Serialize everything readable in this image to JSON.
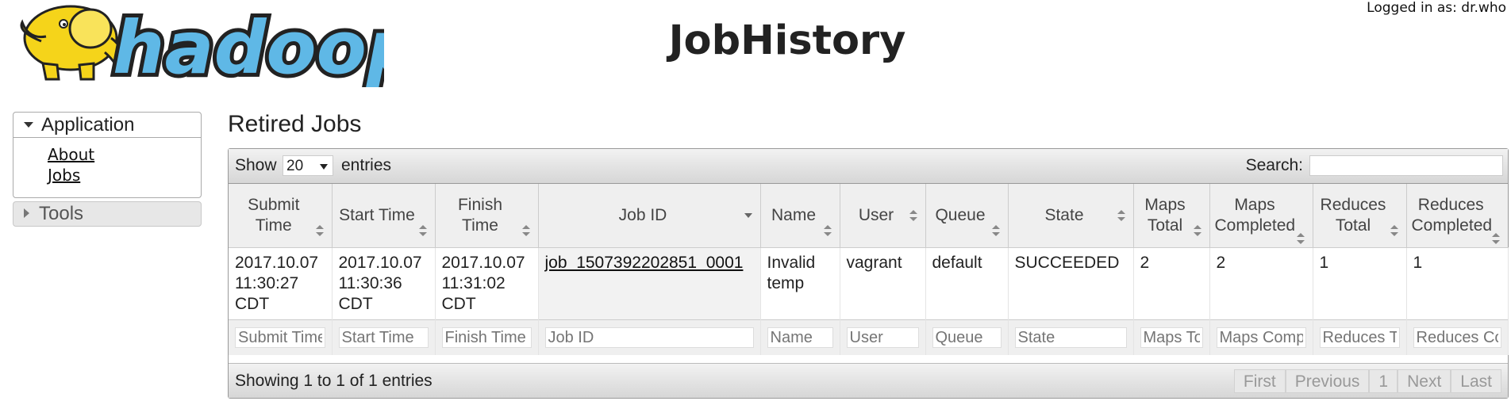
{
  "header": {
    "logo_text": "hadoop",
    "title": "JobHistory",
    "logged_in": "Logged in as: dr.who"
  },
  "sidebar": {
    "application": {
      "label": "Application",
      "items": [
        {
          "label": "About"
        },
        {
          "label": "Jobs"
        }
      ]
    },
    "tools": {
      "label": "Tools"
    }
  },
  "main": {
    "heading": "Retired Jobs",
    "show_label": "Show",
    "page_length": "20",
    "entries_label": "entries",
    "search_label": "Search:",
    "search_value": "",
    "info": "Showing 1 to 1 of 1 entries",
    "pager": {
      "first": "First",
      "previous": "Previous",
      "page": "1",
      "next": "Next",
      "last": "Last"
    },
    "columns": [
      {
        "label": "Submit Time"
      },
      {
        "label": "Start Time"
      },
      {
        "label": "Finish Time"
      },
      {
        "label": "Job ID"
      },
      {
        "label": "Name"
      },
      {
        "label": "User"
      },
      {
        "label": "Queue"
      },
      {
        "label": "State"
      },
      {
        "label": "Maps Total"
      },
      {
        "label": "Maps Completed"
      },
      {
        "label": "Reduces Total"
      },
      {
        "label": "Reduces Completed"
      }
    ],
    "rows": [
      {
        "submit_time": "2017.10.07 11:30:27 CDT",
        "start_time": "2017.10.07 11:30:36 CDT",
        "finish_time": "2017.10.07 11:31:02 CDT",
        "job_id": "job_1507392202851_0001",
        "name": "Invalid temp",
        "user": "vagrant",
        "queue": "default",
        "state": "SUCCEEDED",
        "maps_total": "2",
        "maps_completed": "2",
        "reduces_total": "1",
        "reduces_completed": "1"
      }
    ],
    "filters": [
      "Submit Time",
      "Start Time",
      "Finish Time",
      "Job ID",
      "Name",
      "User",
      "Queue",
      "State",
      "Maps Total",
      "Maps Completed",
      "Reduces Total",
      "Reduces Completed"
    ]
  },
  "colors": {
    "logo_yellow": "#f5d41a",
    "logo_blue": "#5fb8e6"
  }
}
